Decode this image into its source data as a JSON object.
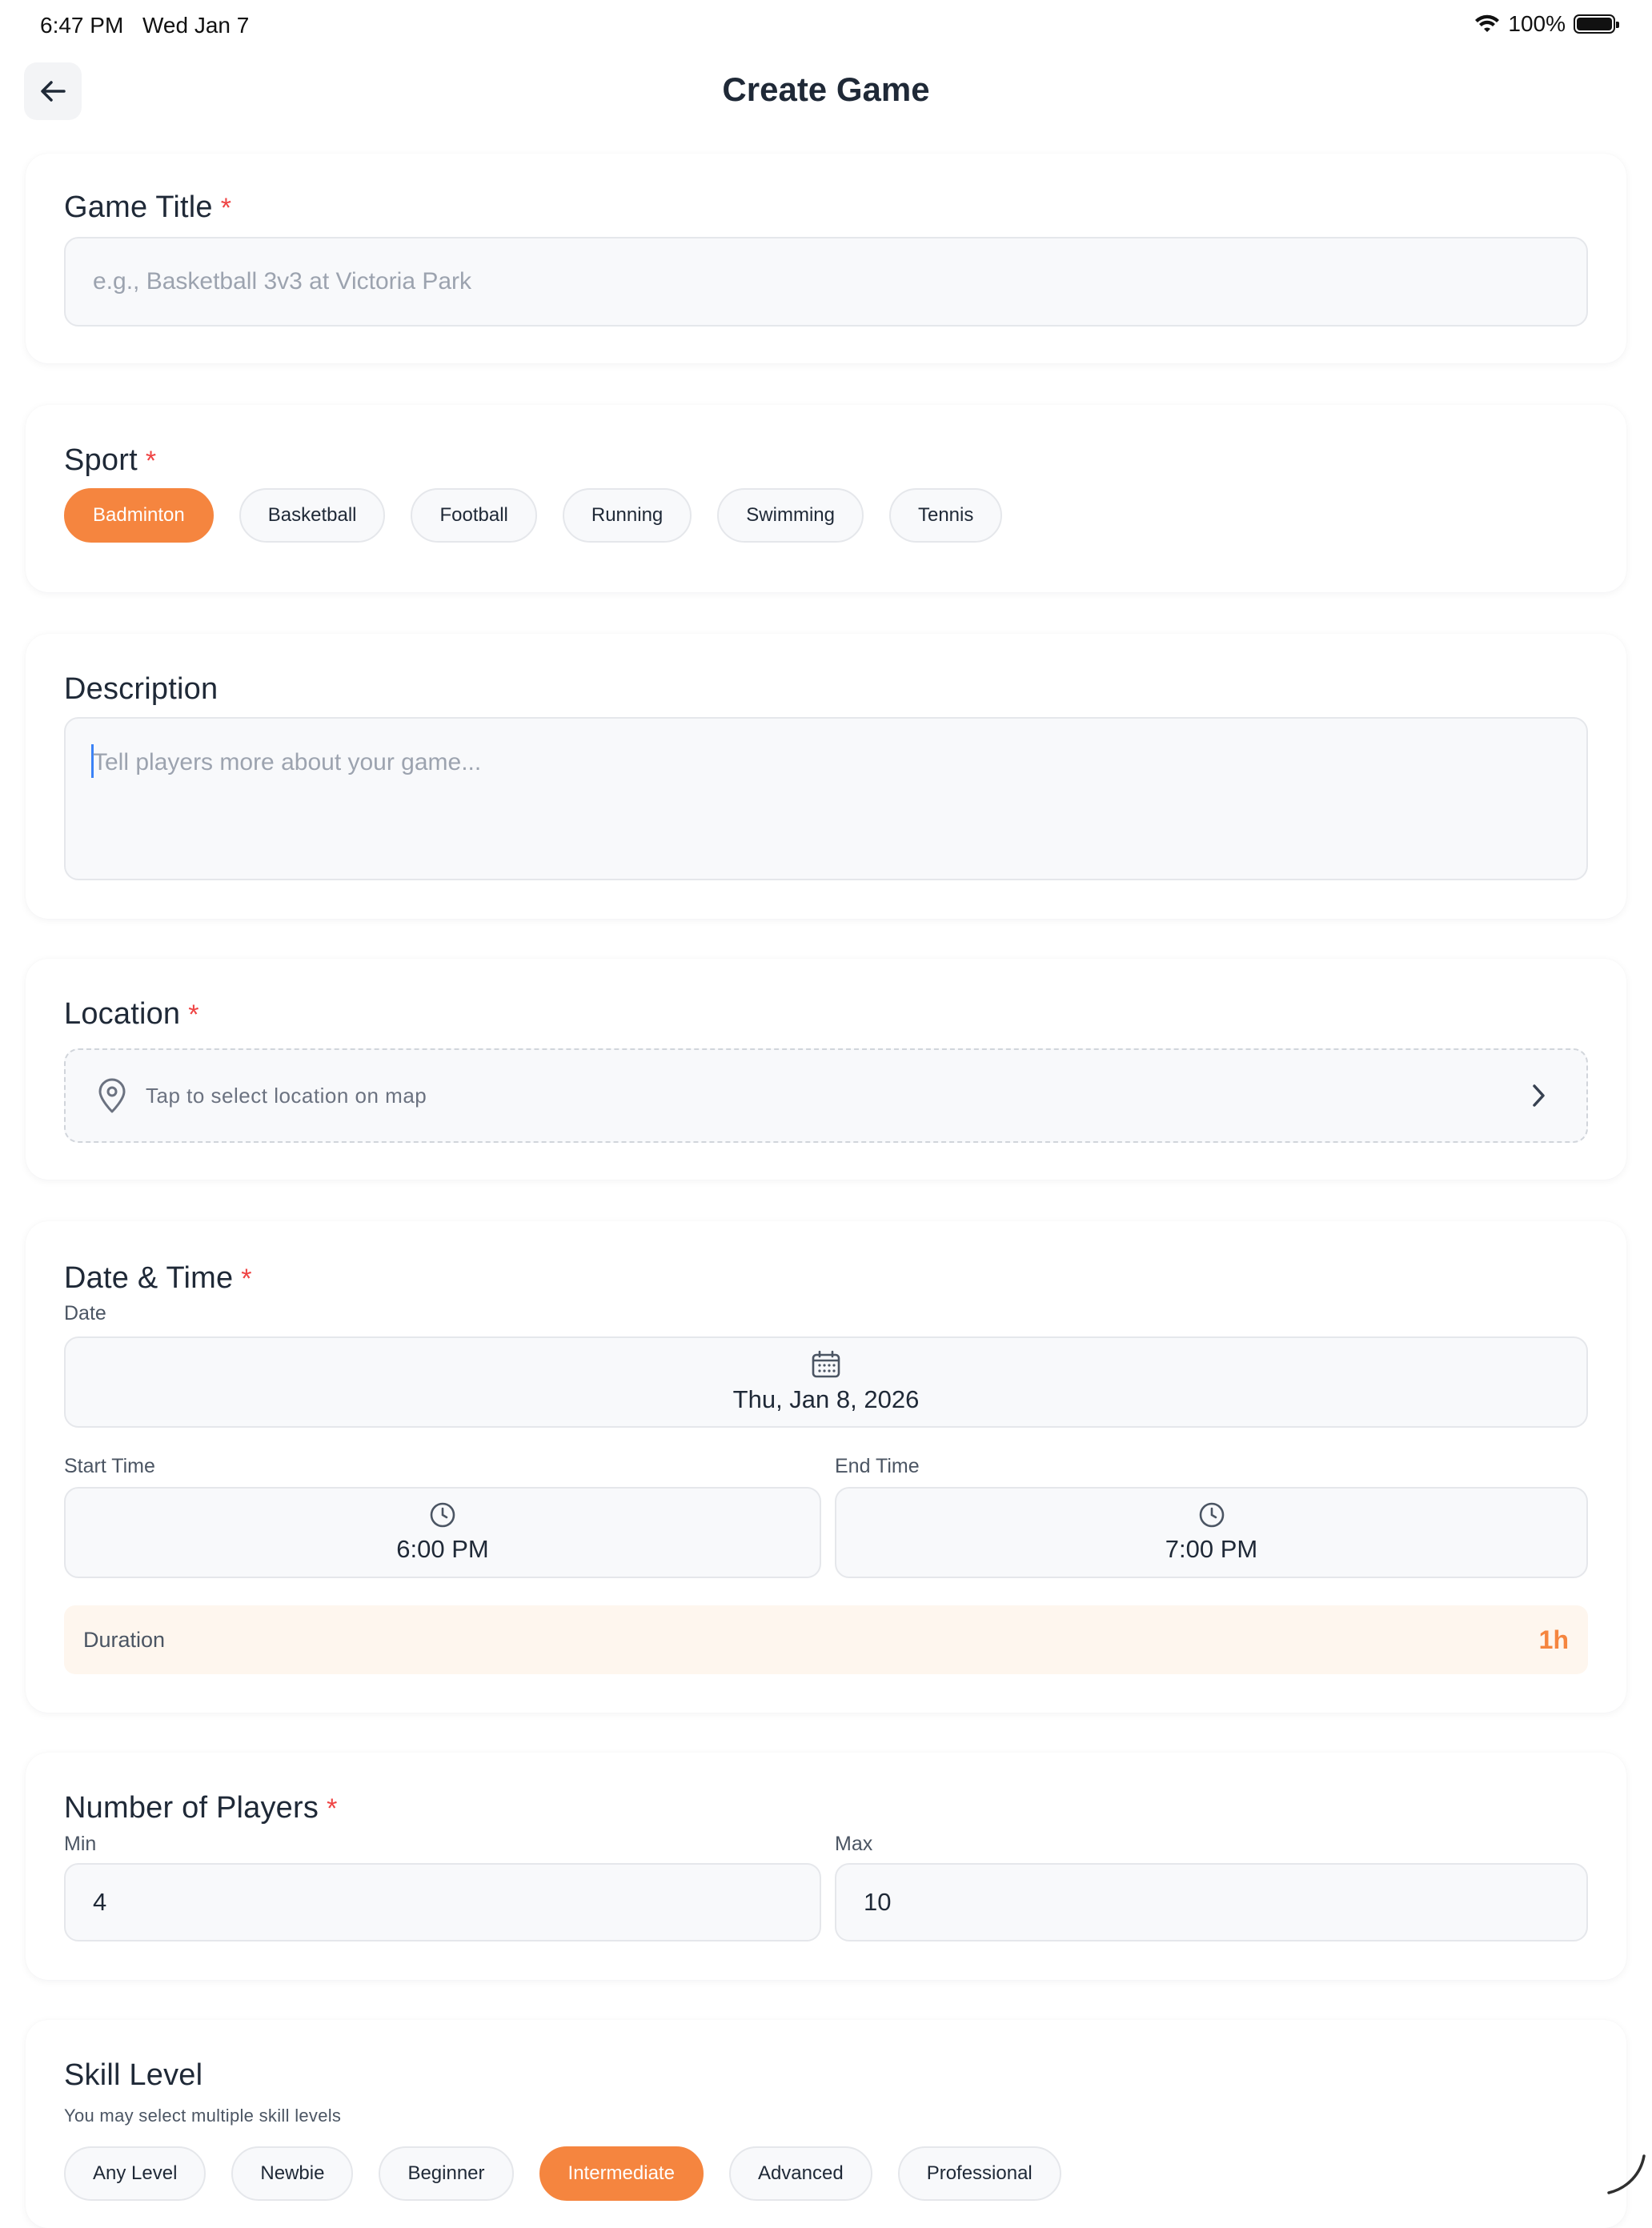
{
  "status_bar": {
    "time": "6:47 PM",
    "date": "Wed Jan 7",
    "battery": "100%"
  },
  "header": {
    "title": "Create Game"
  },
  "game_title": {
    "label": "Game Title",
    "required_mark": "*",
    "placeholder": "e.g., Basketball 3v3 at Victoria Park"
  },
  "sport": {
    "label": "Sport",
    "required_mark": "*",
    "options": [
      "Badminton",
      "Basketball",
      "Football",
      "Running",
      "Swimming",
      "Tennis"
    ],
    "selected": "Badminton"
  },
  "description": {
    "label": "Description",
    "placeholder": "Tell players more about your game..."
  },
  "location": {
    "label": "Location",
    "required_mark": "*",
    "placeholder": "Tap to select location on map"
  },
  "date_time": {
    "label": "Date & Time",
    "required_mark": "*",
    "date_label": "Date",
    "date_value": "Thu, Jan 8, 2026",
    "start_label": "Start Time",
    "start_value": "6:00 PM",
    "end_label": "End Time",
    "end_value": "7:00 PM",
    "duration_label": "Duration",
    "duration_value": "1h"
  },
  "players": {
    "label": "Number of Players",
    "required_mark": "*",
    "min_label": "Min",
    "min_value": "4",
    "max_label": "Max",
    "max_value": "10"
  },
  "skill_level": {
    "label": "Skill Level",
    "hint": "You may select multiple skill levels",
    "options": [
      "Any Level",
      "Newbie",
      "Beginner",
      "Intermediate",
      "Advanced",
      "Professional"
    ],
    "selected": [
      "Intermediate"
    ]
  },
  "colors": {
    "accent": "#f5853f",
    "required": "#ef4444",
    "duration_bg": "#fef6ee"
  },
  "icons": {
    "back": "arrow-left-icon",
    "location": "map-pin-icon",
    "chevron": "chevron-right-icon",
    "date": "calendar-icon",
    "time": "clock-icon"
  }
}
